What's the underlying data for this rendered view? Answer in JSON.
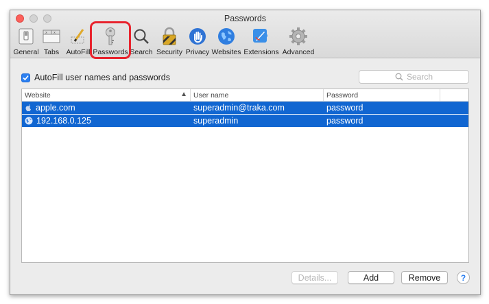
{
  "window": {
    "title": "Passwords"
  },
  "toolbar": {
    "items": [
      {
        "label": "General",
        "icon": "general-switch-icon"
      },
      {
        "label": "Tabs",
        "icon": "tabs-icon"
      },
      {
        "label": "AutoFill",
        "icon": "autofill-pencil-icon"
      },
      {
        "label": "Passwords",
        "icon": "key-icon",
        "selected": true
      },
      {
        "label": "Search",
        "icon": "search-icon"
      },
      {
        "label": "Security",
        "icon": "lock-icon"
      },
      {
        "label": "Privacy",
        "icon": "hand-icon"
      },
      {
        "label": "Websites",
        "icon": "globe-icon"
      },
      {
        "label": "Extensions",
        "icon": "puzzle-icon"
      },
      {
        "label": "Advanced",
        "icon": "gear-icon"
      }
    ],
    "highlight_color": "#e8232d"
  },
  "autofill": {
    "label": "AutoFill user names and passwords",
    "checked": true
  },
  "search": {
    "placeholder": "Search"
  },
  "table": {
    "columns": [
      "Website",
      "User name",
      "Password"
    ],
    "sort_column": "Website",
    "sort_direction": "ascending",
    "rows": [
      {
        "website": "apple.com",
        "username": "superadmin@traka.com",
        "password": "password",
        "icon": "apple-logo-icon",
        "selected": true
      },
      {
        "website": "192.168.0.125",
        "username": "superadmin",
        "password": "password",
        "icon": "globe-icon",
        "selected": true
      }
    ],
    "selection_color": "#1166d1"
  },
  "buttons": {
    "details": "Details...",
    "add": "Add",
    "remove": "Remove",
    "help": "?"
  }
}
